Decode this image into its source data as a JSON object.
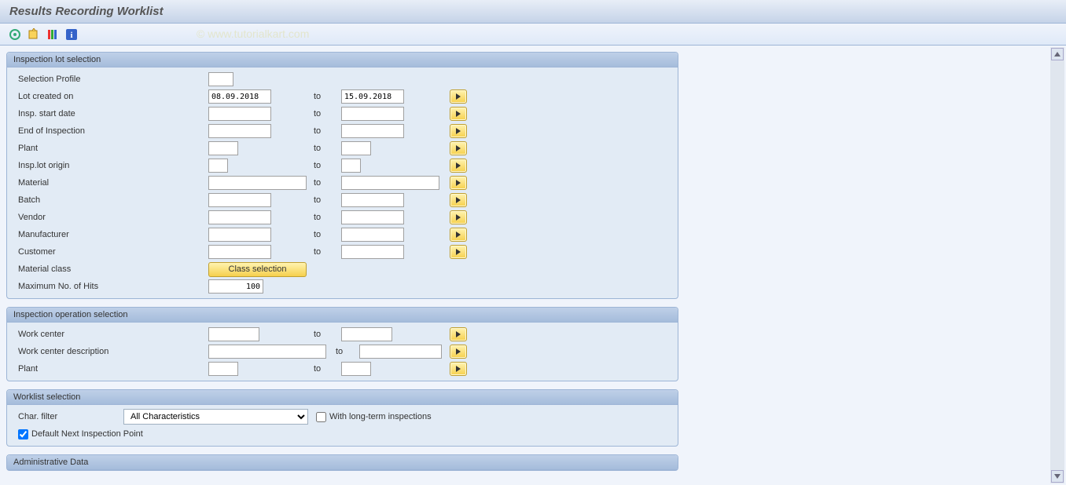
{
  "title": "Results Recording Worklist",
  "watermark": "© www.tutorialkart.com",
  "toolbar": {
    "icons": [
      "execute-icon",
      "get-variant-icon",
      "variant-icon",
      "info-icon"
    ]
  },
  "groups": {
    "lot": {
      "title": "Inspection lot selection",
      "rows": {
        "selprof": {
          "label": "Selection Profile",
          "from": "",
          "to": null
        },
        "created": {
          "label": "Lot created on",
          "from": "08.09.2018",
          "to": "15.09.2018"
        },
        "startdate": {
          "label": "Insp. start date",
          "from": "",
          "to": ""
        },
        "endinsp": {
          "label": "End of Inspection",
          "from": "",
          "to": ""
        },
        "plant": {
          "label": "Plant",
          "from": "",
          "to": ""
        },
        "origin": {
          "label": "Insp.lot origin",
          "from": "",
          "to": ""
        },
        "material": {
          "label": "Material",
          "from": "",
          "to": ""
        },
        "batch": {
          "label": "Batch",
          "from": "",
          "to": ""
        },
        "vendor": {
          "label": "Vendor",
          "from": "",
          "to": ""
        },
        "manuf": {
          "label": "Manufacturer",
          "from": "",
          "to": ""
        },
        "customer": {
          "label": "Customer",
          "from": "",
          "to": ""
        },
        "matclass": {
          "label": "Material class"
        },
        "maxhits": {
          "label": "Maximum No. of Hits",
          "value": "100"
        }
      },
      "class_button": "Class selection",
      "to_label": "to"
    },
    "oper": {
      "title": "Inspection operation selection",
      "rows": {
        "wc": {
          "label": "Work center",
          "from": "",
          "to": ""
        },
        "wcdesc": {
          "label": "Work center description",
          "from": "",
          "to": ""
        },
        "plant2": {
          "label": "Plant",
          "from": "",
          "to": ""
        }
      },
      "to_label": "to"
    },
    "worklist": {
      "title": "Worklist selection",
      "charfilter_label": "Char. filter",
      "charfilter_value": "All Characteristics",
      "longterm_label": "With long-term inspections",
      "longterm_checked": false,
      "default_next_label": "Default Next Inspection Point",
      "default_next_checked": true
    },
    "admin": {
      "title": "Administrative Data"
    }
  }
}
